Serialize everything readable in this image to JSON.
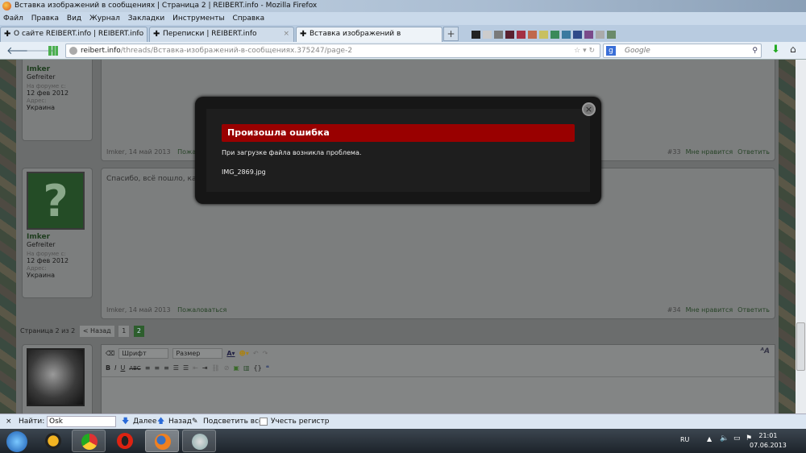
{
  "window": {
    "title": "Вставка изображений в сообщениях | Страница 2 | REIBERT.info - Mozilla Firefox"
  },
  "menu": [
    "Файл",
    "Правка",
    "Вид",
    "Журнал",
    "Закладки",
    "Инструменты",
    "Справка"
  ],
  "tabs": [
    {
      "label": "О сайте REIBERT.info | REIBERT.info"
    },
    {
      "label": "Переписки | REIBERT.info"
    },
    {
      "label": "Вставка изображений в сообщения..."
    }
  ],
  "newtab": "+",
  "nav": {
    "url_host": "reibert.info",
    "url_path": "/threads/Вставка-изображений-в-сообщениях.375247/page-2",
    "search_placeholder": "Google"
  },
  "posts": [
    {
      "user": "Imker",
      "rank": "Gefreiter",
      "since_label": "На форуме с:",
      "since": "12 фев 2012",
      "addr_label": "Адрес:",
      "addr": "Украина",
      "text": "",
      "author_date": "Imker, 14 май 2013",
      "report": "Пожаловаться",
      "num": "#33",
      "like": "Мне нравится",
      "reply": "Ответить"
    },
    {
      "user": "Imker",
      "rank": "Gefreiter",
      "since_label": "На форуме с:",
      "since": "12 фев 2012",
      "addr_label": "Адрес:",
      "addr": "Украина",
      "text": "Спасибо, всё пошло, как по свечке",
      "author_date": "Imker, 14 май 2013",
      "report": "Пожаловаться",
      "num": "#34",
      "like": "Мне нравится",
      "reply": "Ответить"
    }
  ],
  "pager": {
    "label": "Страница 2 из 2",
    "prev": "< Назад",
    "pages": [
      "1",
      "2"
    ]
  },
  "editor": {
    "font": "Шрифт",
    "size": "Размер",
    "bold": "B",
    "italic": "I",
    "underline": "U",
    "strike": "ABC"
  },
  "modal": {
    "title": "Произошла ошибка",
    "message": "При загрузке файла возникла проблема.",
    "file": "IMG_2869.jpg",
    "close": "×"
  },
  "findbar": {
    "close": "×",
    "label": "Найти:",
    "value": "Osk",
    "next": "Далее",
    "prev": "Назад",
    "highlight": "Подсветить все",
    "matchcase": "Учесть регистр"
  },
  "tray": {
    "lang": "RU",
    "time": "21:01",
    "date": "07.06.2013"
  }
}
